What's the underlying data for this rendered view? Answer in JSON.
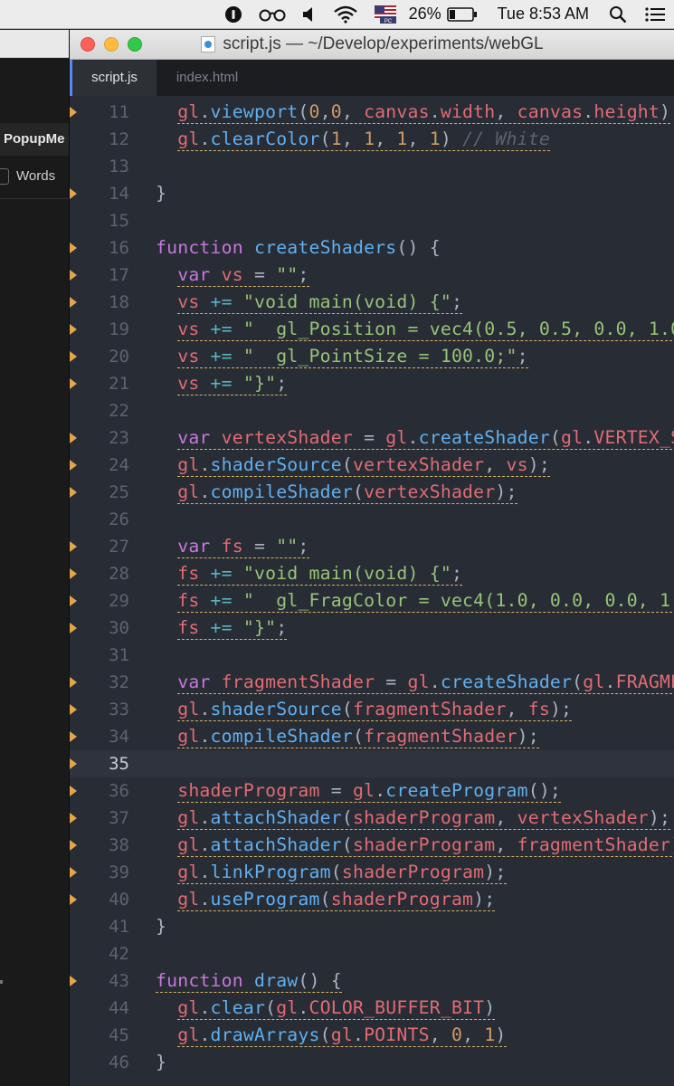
{
  "menubar": {
    "battery_percent": "26%",
    "clock": "Tue 8:53 AM",
    "flag_label": "PC"
  },
  "background_app": {
    "popup_label": "PopupMe",
    "words_label": "Words"
  },
  "window": {
    "title": "script.js — ~/Develop/experiments/webGL",
    "tabs": [
      {
        "label": "script.js",
        "active": true
      },
      {
        "label": "index.html",
        "active": false
      }
    ]
  },
  "editor": {
    "cursor_line": 35,
    "lines": [
      {
        "n": "11",
        "fold": true,
        "tokens": [
          [
            "pl",
            "  "
          ],
          [
            "v",
            "gl"
          ],
          [
            "p",
            "."
          ],
          [
            "f",
            "viewport"
          ],
          [
            "p",
            "("
          ],
          [
            "n",
            "0"
          ],
          [
            "p",
            ","
          ],
          [
            "n",
            "0"
          ],
          [
            "p",
            ", "
          ],
          [
            "v",
            "canvas"
          ],
          [
            "p",
            "."
          ],
          [
            "v",
            "width"
          ],
          [
            "p",
            ", "
          ],
          [
            "v",
            "canvas"
          ],
          [
            "p",
            "."
          ],
          [
            "v",
            "height"
          ],
          [
            "p",
            ")"
          ]
        ]
      },
      {
        "n": "12",
        "fold": false,
        "tokens": [
          [
            "pl",
            "  "
          ],
          [
            "v",
            "gl"
          ],
          [
            "p",
            "."
          ],
          [
            "f",
            "clearColor"
          ],
          [
            "p",
            "("
          ],
          [
            "n",
            "1"
          ],
          [
            "p",
            ", "
          ],
          [
            "n",
            "1"
          ],
          [
            "p",
            ", "
          ],
          [
            "n",
            "1"
          ],
          [
            "p",
            ", "
          ],
          [
            "n",
            "1"
          ],
          [
            "p",
            ") "
          ],
          [
            "c",
            "// White"
          ]
        ]
      },
      {
        "n": "13",
        "fold": false,
        "tokens": []
      },
      {
        "n": "14",
        "fold": true,
        "tokens": [
          [
            "p",
            "}"
          ]
        ]
      },
      {
        "n": "15",
        "fold": false,
        "tokens": []
      },
      {
        "n": "16",
        "fold": true,
        "tokens": [
          [
            "k",
            "function "
          ],
          [
            "f",
            "createShaders"
          ],
          [
            "p",
            "() {"
          ]
        ]
      },
      {
        "n": "17",
        "fold": true,
        "tokens": [
          [
            "pl",
            "  "
          ],
          [
            "k",
            "var "
          ],
          [
            "v",
            "vs"
          ],
          [
            "p",
            " = "
          ],
          [
            "str",
            "\"\""
          ],
          [
            "p",
            ";"
          ]
        ]
      },
      {
        "n": "18",
        "fold": true,
        "tokens": [
          [
            "pl",
            "  "
          ],
          [
            "v",
            "vs"
          ],
          [
            "o",
            " += "
          ],
          [
            "str",
            "\"void main(void) {\""
          ],
          [
            "p",
            ";"
          ]
        ]
      },
      {
        "n": "19",
        "fold": true,
        "tokens": [
          [
            "pl",
            "  "
          ],
          [
            "v",
            "vs"
          ],
          [
            "o",
            " += "
          ],
          [
            "str",
            "\"  gl_Position = vec4(0.5, 0.5, 0.0, 1.0"
          ]
        ]
      },
      {
        "n": "20",
        "fold": true,
        "tokens": [
          [
            "pl",
            "  "
          ],
          [
            "v",
            "vs"
          ],
          [
            "o",
            " += "
          ],
          [
            "str",
            "\"  gl_PointSize = 100.0;\""
          ],
          [
            "p",
            ";"
          ]
        ]
      },
      {
        "n": "21",
        "fold": true,
        "tokens": [
          [
            "pl",
            "  "
          ],
          [
            "v",
            "vs"
          ],
          [
            "o",
            " += "
          ],
          [
            "str",
            "\"}\""
          ],
          [
            "p",
            ";"
          ]
        ]
      },
      {
        "n": "22",
        "fold": false,
        "tokens": []
      },
      {
        "n": "23",
        "fold": true,
        "tokens": [
          [
            "pl",
            "  "
          ],
          [
            "k",
            "var "
          ],
          [
            "v",
            "vertexShader"
          ],
          [
            "p",
            " = "
          ],
          [
            "v",
            "gl"
          ],
          [
            "p",
            "."
          ],
          [
            "f",
            "createShader"
          ],
          [
            "p",
            "("
          ],
          [
            "v",
            "gl"
          ],
          [
            "p",
            "."
          ],
          [
            "v",
            "VERTEX_S"
          ]
        ]
      },
      {
        "n": "24",
        "fold": true,
        "tokens": [
          [
            "pl",
            "  "
          ],
          [
            "v",
            "gl"
          ],
          [
            "p",
            "."
          ],
          [
            "f",
            "shaderSource"
          ],
          [
            "p",
            "("
          ],
          [
            "v",
            "vertexShader"
          ],
          [
            "p",
            ", "
          ],
          [
            "v",
            "vs"
          ],
          [
            "p",
            ");"
          ]
        ]
      },
      {
        "n": "25",
        "fold": true,
        "tokens": [
          [
            "pl",
            "  "
          ],
          [
            "v",
            "gl"
          ],
          [
            "p",
            "."
          ],
          [
            "f",
            "compileShader"
          ],
          [
            "p",
            "("
          ],
          [
            "v",
            "vertexShader"
          ],
          [
            "p",
            ");"
          ]
        ]
      },
      {
        "n": "26",
        "fold": false,
        "tokens": []
      },
      {
        "n": "27",
        "fold": true,
        "tokens": [
          [
            "pl",
            "  "
          ],
          [
            "k",
            "var "
          ],
          [
            "v",
            "fs"
          ],
          [
            "p",
            " = "
          ],
          [
            "str",
            "\"\""
          ],
          [
            "p",
            ";"
          ]
        ]
      },
      {
        "n": "28",
        "fold": true,
        "tokens": [
          [
            "pl",
            "  "
          ],
          [
            "v",
            "fs"
          ],
          [
            "o",
            " += "
          ],
          [
            "str",
            "\"void main(void) {\""
          ],
          [
            "p",
            ";"
          ]
        ]
      },
      {
        "n": "29",
        "fold": true,
        "tokens": [
          [
            "pl",
            "  "
          ],
          [
            "v",
            "fs"
          ],
          [
            "o",
            " += "
          ],
          [
            "str",
            "\"  gl_FragColor = vec4(1.0, 0.0, 0.0, 1."
          ]
        ]
      },
      {
        "n": "30",
        "fold": true,
        "tokens": [
          [
            "pl",
            "  "
          ],
          [
            "v",
            "fs"
          ],
          [
            "o",
            " += "
          ],
          [
            "str",
            "\"}\""
          ],
          [
            "p",
            ";"
          ]
        ]
      },
      {
        "n": "31",
        "fold": false,
        "tokens": []
      },
      {
        "n": "32",
        "fold": true,
        "tokens": [
          [
            "pl",
            "  "
          ],
          [
            "k",
            "var "
          ],
          [
            "v",
            "fragmentShader"
          ],
          [
            "p",
            " = "
          ],
          [
            "v",
            "gl"
          ],
          [
            "p",
            "."
          ],
          [
            "f",
            "createShader"
          ],
          [
            "p",
            "("
          ],
          [
            "v",
            "gl"
          ],
          [
            "p",
            "."
          ],
          [
            "v",
            "FRAGME"
          ]
        ]
      },
      {
        "n": "33",
        "fold": true,
        "tokens": [
          [
            "pl",
            "  "
          ],
          [
            "v",
            "gl"
          ],
          [
            "p",
            "."
          ],
          [
            "f",
            "shaderSource"
          ],
          [
            "p",
            "("
          ],
          [
            "v",
            "fragmentShader"
          ],
          [
            "p",
            ", "
          ],
          [
            "v",
            "fs"
          ],
          [
            "p",
            ");"
          ]
        ]
      },
      {
        "n": "34",
        "fold": true,
        "tokens": [
          [
            "pl",
            "  "
          ],
          [
            "v",
            "gl"
          ],
          [
            "p",
            "."
          ],
          [
            "f",
            "compileShader"
          ],
          [
            "p",
            "("
          ],
          [
            "v",
            "fragmentShader"
          ],
          [
            "p",
            ");"
          ]
        ]
      },
      {
        "n": "35",
        "fold": true,
        "tokens": []
      },
      {
        "n": "36",
        "fold": true,
        "tokens": [
          [
            "pl",
            "  "
          ],
          [
            "v",
            "shaderProgram"
          ],
          [
            "p",
            " = "
          ],
          [
            "v",
            "gl"
          ],
          [
            "p",
            "."
          ],
          [
            "f",
            "createProgram"
          ],
          [
            "p",
            "();"
          ]
        ]
      },
      {
        "n": "37",
        "fold": true,
        "tokens": [
          [
            "pl",
            "  "
          ],
          [
            "v",
            "gl"
          ],
          [
            "p",
            "."
          ],
          [
            "f",
            "attachShader"
          ],
          [
            "p",
            "("
          ],
          [
            "v",
            "shaderProgram"
          ],
          [
            "p",
            ", "
          ],
          [
            "v",
            "vertexShader"
          ],
          [
            "p",
            ");"
          ]
        ]
      },
      {
        "n": "38",
        "fold": true,
        "tokens": [
          [
            "pl",
            "  "
          ],
          [
            "v",
            "gl"
          ],
          [
            "p",
            "."
          ],
          [
            "f",
            "attachShader"
          ],
          [
            "p",
            "("
          ],
          [
            "v",
            "shaderProgram"
          ],
          [
            "p",
            ", "
          ],
          [
            "v",
            "fragmentShader"
          ],
          [
            "p",
            ")"
          ]
        ]
      },
      {
        "n": "39",
        "fold": true,
        "tokens": [
          [
            "pl",
            "  "
          ],
          [
            "v",
            "gl"
          ],
          [
            "p",
            "."
          ],
          [
            "f",
            "linkProgram"
          ],
          [
            "p",
            "("
          ],
          [
            "v",
            "shaderProgram"
          ],
          [
            "p",
            ");"
          ]
        ]
      },
      {
        "n": "40",
        "fold": true,
        "tokens": [
          [
            "pl",
            "  "
          ],
          [
            "v",
            "gl"
          ],
          [
            "p",
            "."
          ],
          [
            "f",
            "useProgram"
          ],
          [
            "p",
            "("
          ],
          [
            "v",
            "shaderProgram"
          ],
          [
            "p",
            ");"
          ]
        ]
      },
      {
        "n": "41",
        "fold": false,
        "tokens": [
          [
            "p",
            "}"
          ]
        ]
      },
      {
        "n": "42",
        "fold": false,
        "tokens": []
      },
      {
        "n": "43",
        "fold": true,
        "tokens": [
          [
            "k",
            "function "
          ],
          [
            "f",
            "draw"
          ],
          [
            "p",
            "() {"
          ]
        ]
      },
      {
        "n": "44",
        "fold": false,
        "tokens": [
          [
            "pl",
            "  "
          ],
          [
            "v",
            "gl"
          ],
          [
            "p",
            "."
          ],
          [
            "f",
            "clear"
          ],
          [
            "p",
            "("
          ],
          [
            "v",
            "gl"
          ],
          [
            "p",
            "."
          ],
          [
            "v",
            "COLOR_BUFFER_BIT"
          ],
          [
            "p",
            ")"
          ]
        ]
      },
      {
        "n": "45",
        "fold": false,
        "tokens": [
          [
            "pl",
            "  "
          ],
          [
            "v",
            "gl"
          ],
          [
            "p",
            "."
          ],
          [
            "f",
            "drawArrays"
          ],
          [
            "p",
            "("
          ],
          [
            "v",
            "gl"
          ],
          [
            "p",
            "."
          ],
          [
            "v",
            "POINTS"
          ],
          [
            "p",
            ", "
          ],
          [
            "n",
            "0"
          ],
          [
            "p",
            ", "
          ],
          [
            "n",
            "1"
          ],
          [
            "p",
            ")"
          ]
        ]
      },
      {
        "n": "46",
        "fold": false,
        "tokens": [
          [
            "p",
            "}"
          ]
        ]
      }
    ]
  }
}
